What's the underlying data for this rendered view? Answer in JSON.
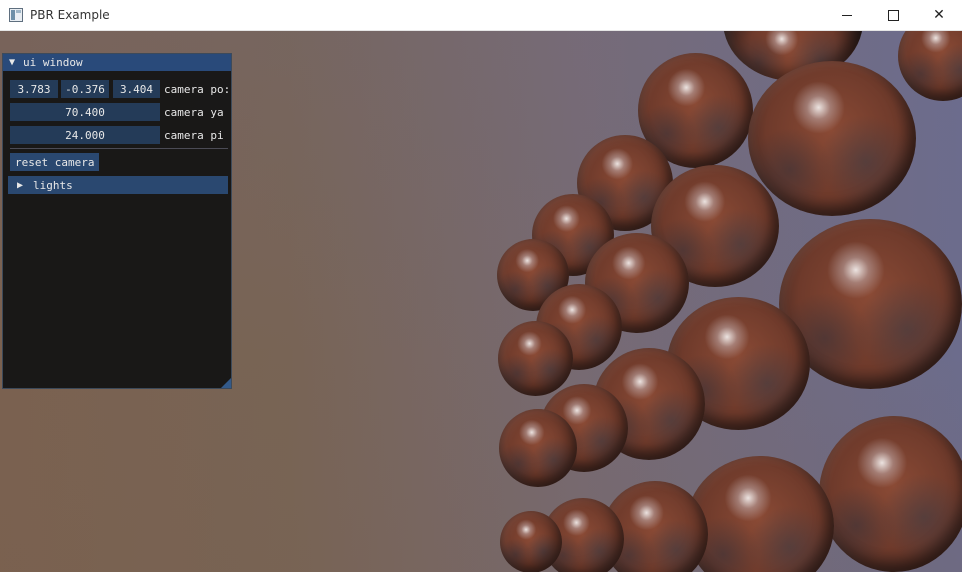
{
  "window": {
    "title": "PBR Example",
    "controls": {
      "minimize": "minimize",
      "maximize": "maximize",
      "close": "close"
    }
  },
  "ui_window": {
    "title": "ui window",
    "camera_pos": {
      "x": "3.783",
      "y": "-0.376",
      "z": "3.404",
      "label": "camera po:"
    },
    "camera_yaw": {
      "value": "70.400",
      "label": "camera ya"
    },
    "camera_pitch": {
      "value": "24.000",
      "label": "camera pi"
    },
    "reset_button": "reset camera",
    "lights_node": "lights"
  },
  "icons": {
    "app": "app-window-icon",
    "collapse": "triangle-down-icon",
    "expand": "triangle-right-icon",
    "resize": "resize-grip-icon"
  },
  "colors": {
    "header": "#294a7a",
    "field": "#243b58",
    "button": "#2a4870",
    "panel_bg": "#141414"
  }
}
